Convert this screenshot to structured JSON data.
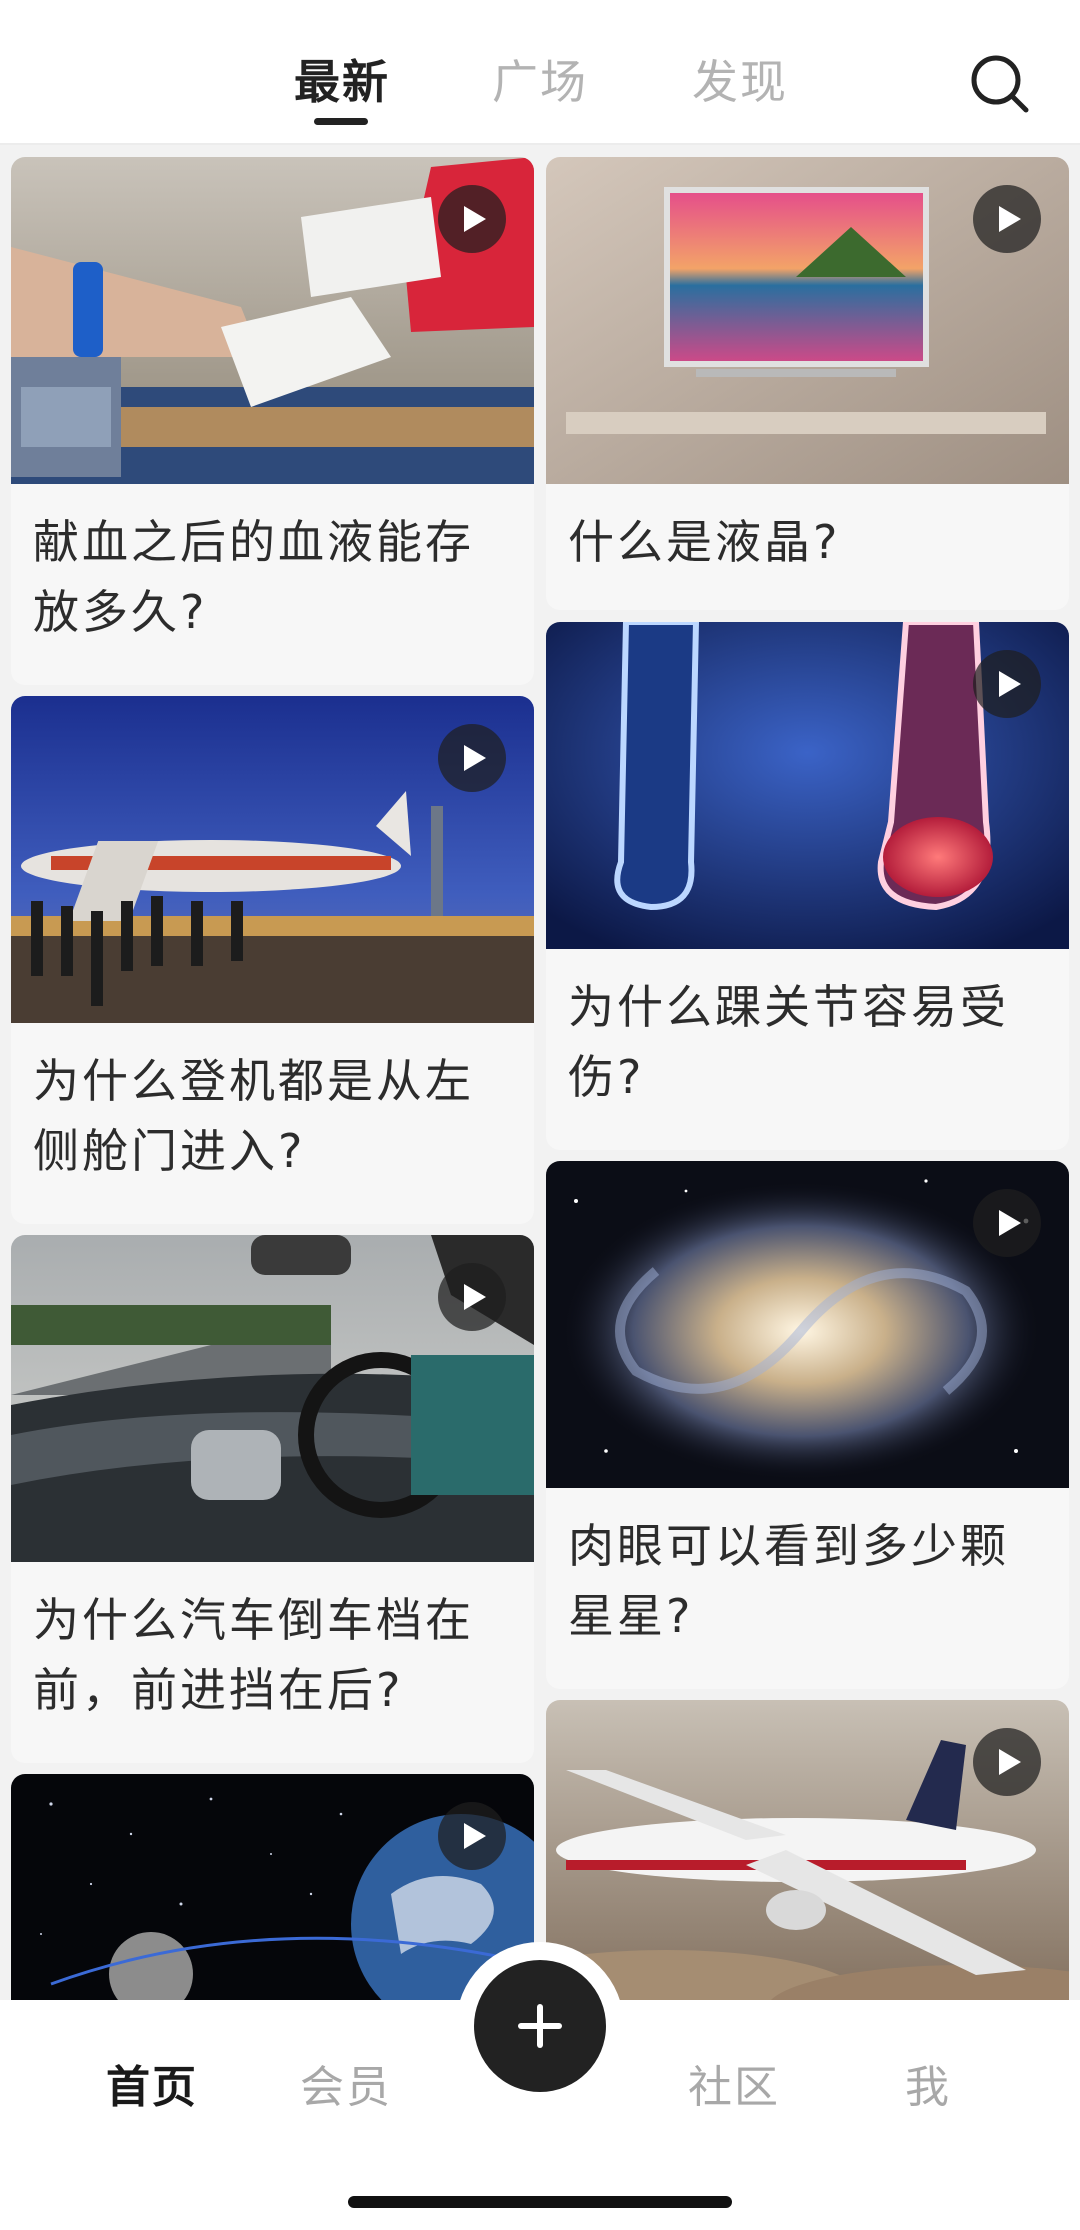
{
  "top_tabs": [
    {
      "label": "最新",
      "active": true
    },
    {
      "label": "广场",
      "active": false
    },
    {
      "label": "发现",
      "active": false
    }
  ],
  "search": {
    "icon": "search-icon"
  },
  "feed": {
    "left_column": [
      {
        "title": "献血之后的血液能存放多久?",
        "image": "blood-donation-photo",
        "has_video": true
      },
      {
        "title": "为什么登机都是从左侧舱门进入?",
        "image": "airport-boarding-photo",
        "has_video": true
      },
      {
        "title": "为什么汽车倒车档在前，前进挡在后?",
        "image": "car-dashboard-photo",
        "has_video": true
      },
      {
        "title": "",
        "image": "earth-moon-space-photo",
        "has_video": true
      }
    ],
    "right_column": [
      {
        "title": "什么是液晶?",
        "image": "lcd-tv-photo",
        "has_video": true
      },
      {
        "title": "为什么踝关节容易受伤?",
        "image": "ankle-xray-photo",
        "has_video": true
      },
      {
        "title": "肉眼可以看到多少颗星星?",
        "image": "spiral-galaxy-photo",
        "has_video": true
      },
      {
        "title": "",
        "image": "jet-airliner-photo",
        "has_video": true
      }
    ]
  },
  "bottom_nav": {
    "items": [
      {
        "label": "首页",
        "active": true
      },
      {
        "label": "会员",
        "active": false
      },
      {
        "label": "社区",
        "active": false
      },
      {
        "label": "我",
        "active": false
      }
    ],
    "fab_icon": "plus-icon"
  },
  "colors": {
    "active_text": "#222222",
    "inactive_text": "#b3b3b3",
    "feed_background": "#f2f2f2",
    "card_background": "#f7f7f7",
    "fab": "#222222"
  }
}
